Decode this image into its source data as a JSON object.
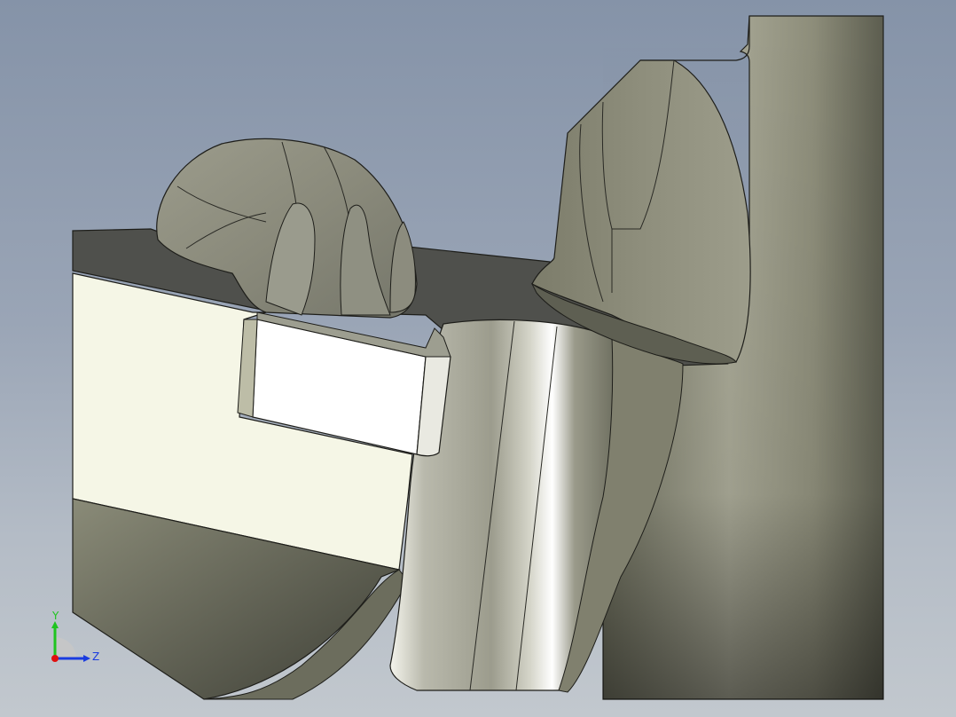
{
  "viewport": {
    "background_top": "#8593a8",
    "background_bottom": "#c2c8ce"
  },
  "triad": {
    "y_label": "Y",
    "z_label": "Z",
    "x_color": "#e01010",
    "y_color": "#1fc41f",
    "z_color": "#1a3ce0"
  }
}
